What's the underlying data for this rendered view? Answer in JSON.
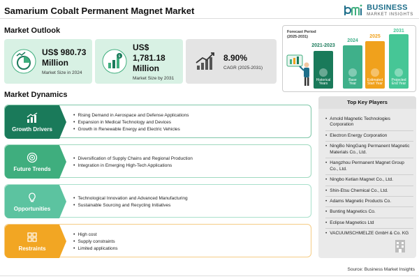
{
  "header": {
    "title": "Samarium Cobalt Permanent Magnet Market",
    "logo_line1": "BUSINESS",
    "logo_line2": "MARKET INSIGHTS",
    "logo_mark_text": "bmi"
  },
  "outlook": {
    "heading": "Market Outlook",
    "cards": [
      {
        "value": "US$ 980.73",
        "value2": "Million",
        "label": "Market Size in 2024",
        "icon": "pie-growth-icon"
      },
      {
        "value": "US$ 1,781.18",
        "value2": "Million",
        "label": "Market Size by 2031",
        "icon": "bar-dollar-icon"
      },
      {
        "value": "8.90%",
        "value2": "",
        "label": "CAGR (2025-2031)",
        "icon": "trend-up-icon"
      }
    ]
  },
  "forecast": {
    "label_line1": "Forecast Period",
    "label_line2": "(2025-2031)",
    "columns": [
      {
        "year": "2021-2023",
        "caption1": "Historical",
        "caption2": "Years",
        "color": "#1a7a5a"
      },
      {
        "year": "2024",
        "caption1": "Base",
        "caption2": "Year",
        "color": "#3fb08a"
      },
      {
        "year": "2025",
        "caption1": "Estimated",
        "caption2": "Start Year",
        "color": "#f0a11c"
      },
      {
        "year": "2031",
        "caption1": "Projected",
        "caption2": "End Year",
        "color": "#46c696"
      }
    ]
  },
  "dynamics": {
    "heading": "Market Dynamics",
    "rows": [
      {
        "name": "Growth Drivers",
        "color": "#1a7a5a",
        "border": "#7fc7a8",
        "icon": "bar-chart-icon",
        "points": [
          "Rising Demand in Aerospace and Defense Applications",
          "Expansion in Medical Technology and Devices",
          "Growth in Renewable Energy and Electric Vehicles"
        ]
      },
      {
        "name": "Future Trends",
        "color": "#3fae7e",
        "border": "#9fd9bf",
        "icon": "target-icon",
        "points": [
          "Diversification of Supply Chains and Regional Production",
          "Integration in Emerging High-Tech Applications"
        ]
      },
      {
        "name": "Opportunities",
        "color": "#5cc3a0",
        "border": "#a9e0cb",
        "icon": "lightbulb-icon",
        "points": [
          "Technological Innovation and Advanced Manufacturing",
          "Sustainable Sourcing and Recycling Initiatives"
        ]
      },
      {
        "name": "Restraints",
        "color": "#f2a623",
        "border": "#f5cc85",
        "icon": "warning-grid-icon",
        "points": [
          "High cost",
          "Supply constraints",
          "Limited applications"
        ]
      }
    ]
  },
  "players": {
    "heading": "Top Key Players",
    "items": [
      "Arnold Magnetic Technologies Corporation",
      "Electron Energy Corporation",
      "NingBo NingGang Permanent Magnetic Materials Co., Ltd.",
      "Hangzhou Permanent Magnet Group Co., Ltd.",
      "Ningbo Ketian Magnet Co., Ltd.",
      "Shin-Etsu Chemical Co., Ltd.",
      "Adams Magnetic Products Co.",
      "Bunting Magnetics Co.",
      "Eclipse Magnetics Ltd",
      "VACUUMSCHMELZE GmbH & Co. KG"
    ]
  },
  "footer": {
    "source": "Source: Business Market Insights"
  }
}
